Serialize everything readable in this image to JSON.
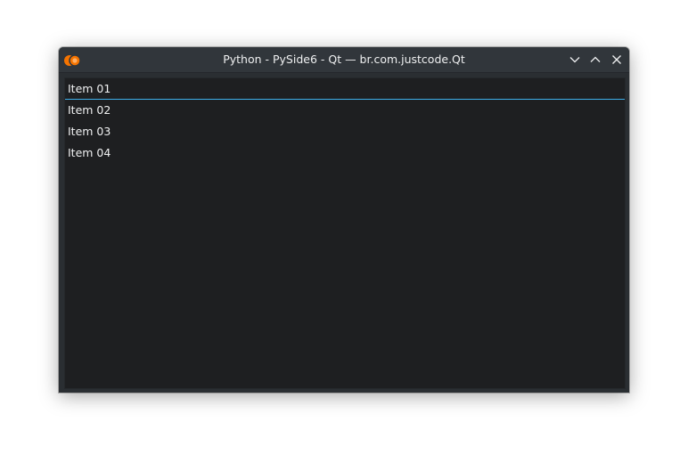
{
  "window": {
    "title": "Python - PySide6 - Qt — br.com.justcode.Qt",
    "app_icon": "kde-app-icon",
    "buttons": {
      "minimize": "chevron-down-icon",
      "maximize": "chevron-up-icon",
      "close": "close-icon"
    }
  },
  "list": {
    "items": [
      {
        "label": "Item 01",
        "current": true
      },
      {
        "label": "Item 02",
        "current": false
      },
      {
        "label": "Item 03",
        "current": false
      },
      {
        "label": "Item 04",
        "current": false
      }
    ]
  },
  "colors": {
    "titlebar": "#31363b",
    "background": "#1e1f21",
    "text": "#eff0f1",
    "accent": "#3daee9",
    "icon_orange": "#f67400"
  }
}
